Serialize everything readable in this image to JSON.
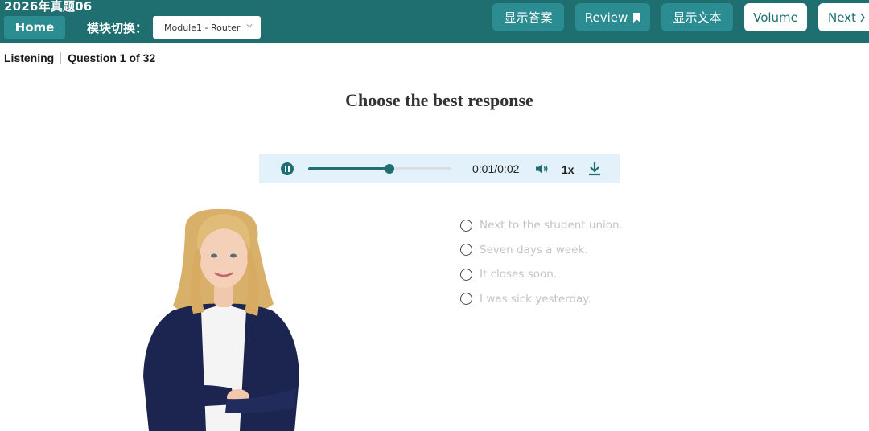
{
  "header": {
    "app_title": "2026年真题06",
    "home_label": "Home",
    "module_label": "模块切换：",
    "module_selected": "Module1 - Router",
    "buttons": {
      "show_answer": "显示答案",
      "review": "Review",
      "show_text": "显示文本",
      "volume": "Volume",
      "next": "Next"
    }
  },
  "subheader": {
    "section": "Listening",
    "question": "Question 1 of 32"
  },
  "prompt": "Choose the best response",
  "player": {
    "time": "0:01/0:02",
    "speed": "1x",
    "progress_fraction": 0.57
  },
  "options": [
    "Next to the student union.",
    "Seven days a week.",
    "It closes soon.",
    "I was sick yesterday."
  ],
  "colors": {
    "brand_teal": "#1f6f70",
    "button_teal": "#2b8c92",
    "player_bg": "#e3f1fb",
    "option_text": "#c4c4c4"
  },
  "icons": [
    "chevron-down-icon",
    "bookmark-icon",
    "chevron-right-icon",
    "pause-icon",
    "volume-icon",
    "download-icon"
  ]
}
